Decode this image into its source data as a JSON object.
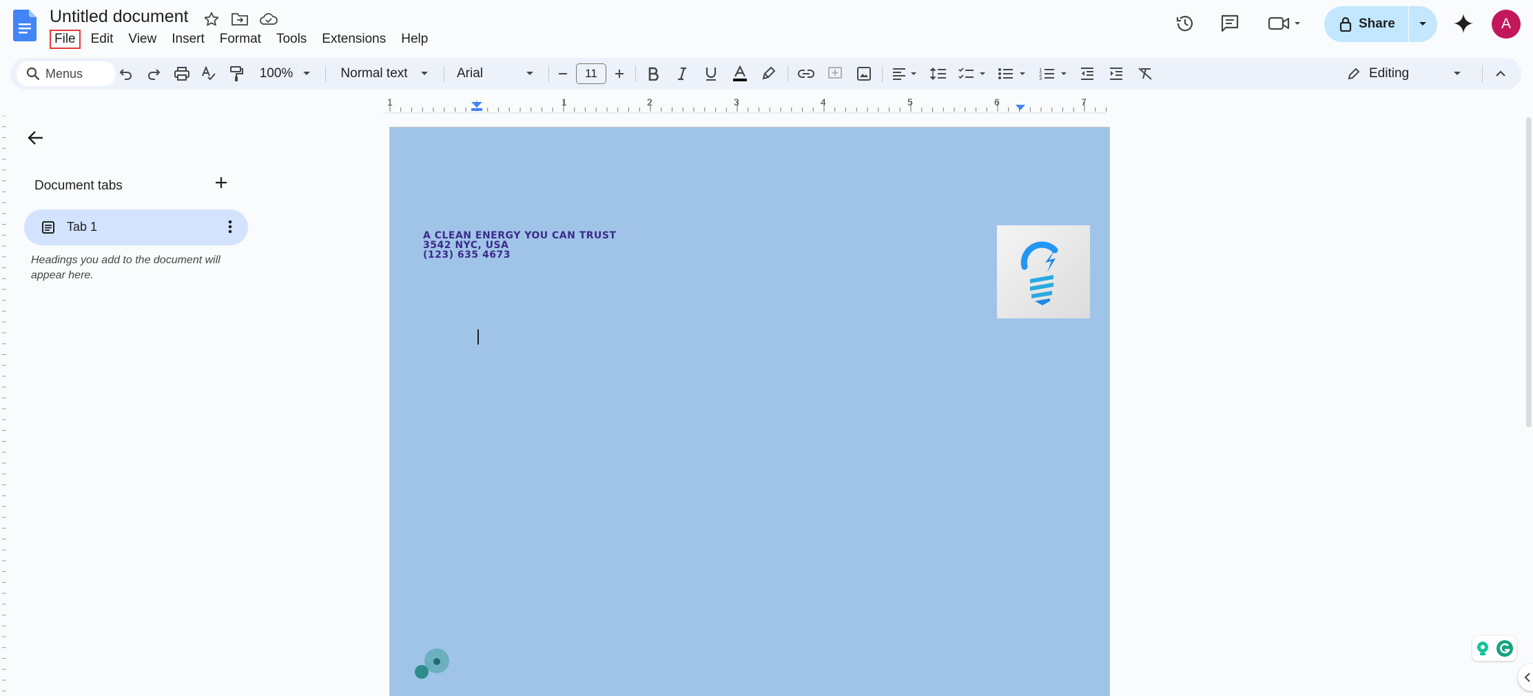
{
  "title_bar": {
    "doc_title": "Untitled document",
    "menu": [
      "File",
      "Edit",
      "View",
      "Insert",
      "Format",
      "Tools",
      "Extensions",
      "Help"
    ],
    "active_menu": "File",
    "share_label": "Share",
    "avatar_initial": "A"
  },
  "toolbar": {
    "search_placeholder": "Menus",
    "zoom": "100%",
    "style": "Normal text",
    "font": "Arial",
    "font_size": "11",
    "mode": "Editing"
  },
  "ruler": {
    "labels": [
      "1",
      "1",
      "2",
      "3",
      "4",
      "5",
      "6",
      "7"
    ]
  },
  "sidebar": {
    "header": "Document tabs",
    "tabs": [
      {
        "label": "Tab 1"
      }
    ],
    "hint": "Headings you add to the document will appear here."
  },
  "document": {
    "letterhead": [
      "A CLEAN ENERGY YOU CAN TRUST",
      "3542 NYC, USA",
      "(123) 635 4673"
    ]
  },
  "colors": {
    "page_background": "#a0c4e8",
    "letterhead_text": "#3b2a8a",
    "share_button": "#c2e7ff",
    "toolbar": "#edf2fa",
    "active_menu_outline": "#e53935",
    "avatar": "#c2185b",
    "tab_selected": "#d3e3fd"
  },
  "icons": {
    "title_bar": [
      "docs-logo-icon",
      "star-icon",
      "move-folder-icon",
      "cloud-saved-icon",
      "history-icon",
      "comments-icon",
      "meet-icon",
      "lock-icon",
      "gemini-sparkle-icon"
    ],
    "toolbar": [
      "search-icon",
      "undo-icon",
      "redo-icon",
      "print-icon",
      "spellcheck-icon",
      "paint-format-icon",
      "bold-icon",
      "italic-icon",
      "underline-icon",
      "text-color-icon",
      "highlight-icon",
      "link-icon",
      "add-comment-icon",
      "insert-image-icon",
      "align-icon",
      "line-spacing-icon",
      "checklist-icon",
      "bullet-list-icon",
      "numbered-list-icon",
      "decrease-indent-icon",
      "increase-indent-icon",
      "clear-formatting-icon",
      "pencil-icon",
      "collapse-icon"
    ],
    "document": [
      "lightbulb-logo-icon",
      "grammarly-icon"
    ]
  }
}
